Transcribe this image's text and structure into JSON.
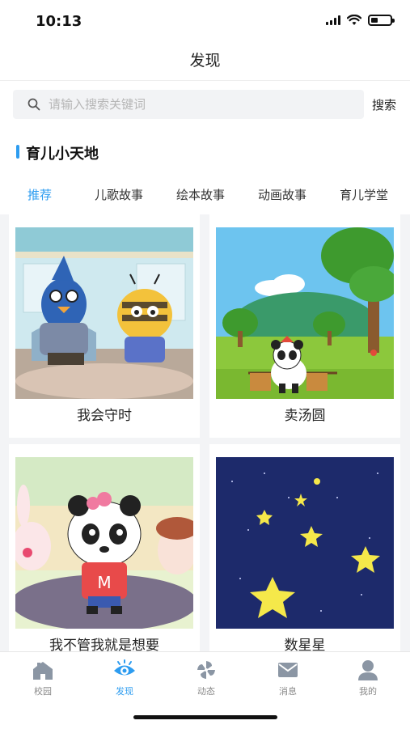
{
  "status": {
    "time": "10:13"
  },
  "header": {
    "title": "发现"
  },
  "search": {
    "placeholder": "请输入搜索关键词",
    "button_label": "搜索"
  },
  "section": {
    "title": "育儿小天地"
  },
  "tabs": [
    {
      "label": "推荐",
      "active": true
    },
    {
      "label": "儿歌故事",
      "active": false
    },
    {
      "label": "绘本故事",
      "active": false
    },
    {
      "label": "动画故事",
      "active": false
    },
    {
      "label": "育儿学堂",
      "active": false
    }
  ],
  "cards": [
    {
      "title": "我会守时",
      "image": "bird-and-bee-cartoon"
    },
    {
      "title": "卖汤圆",
      "image": "panda-selling-tangyuan"
    },
    {
      "title": "我不管我就是想要",
      "image": "panda-girl-cartoon"
    },
    {
      "title": "数星星",
      "image": "stars-night-sky"
    }
  ],
  "tabbar": [
    {
      "label": "校园",
      "icon": "school-icon",
      "active": false
    },
    {
      "label": "发现",
      "icon": "eye-icon",
      "active": true
    },
    {
      "label": "动态",
      "icon": "pinwheel-icon",
      "active": false
    },
    {
      "label": "消息",
      "icon": "mail-icon",
      "active": false
    },
    {
      "label": "我的",
      "icon": "person-icon",
      "active": false
    }
  ],
  "colors": {
    "accent": "#2d9cf0",
    "inactive": "#888888",
    "background": "#f3f4f6"
  }
}
